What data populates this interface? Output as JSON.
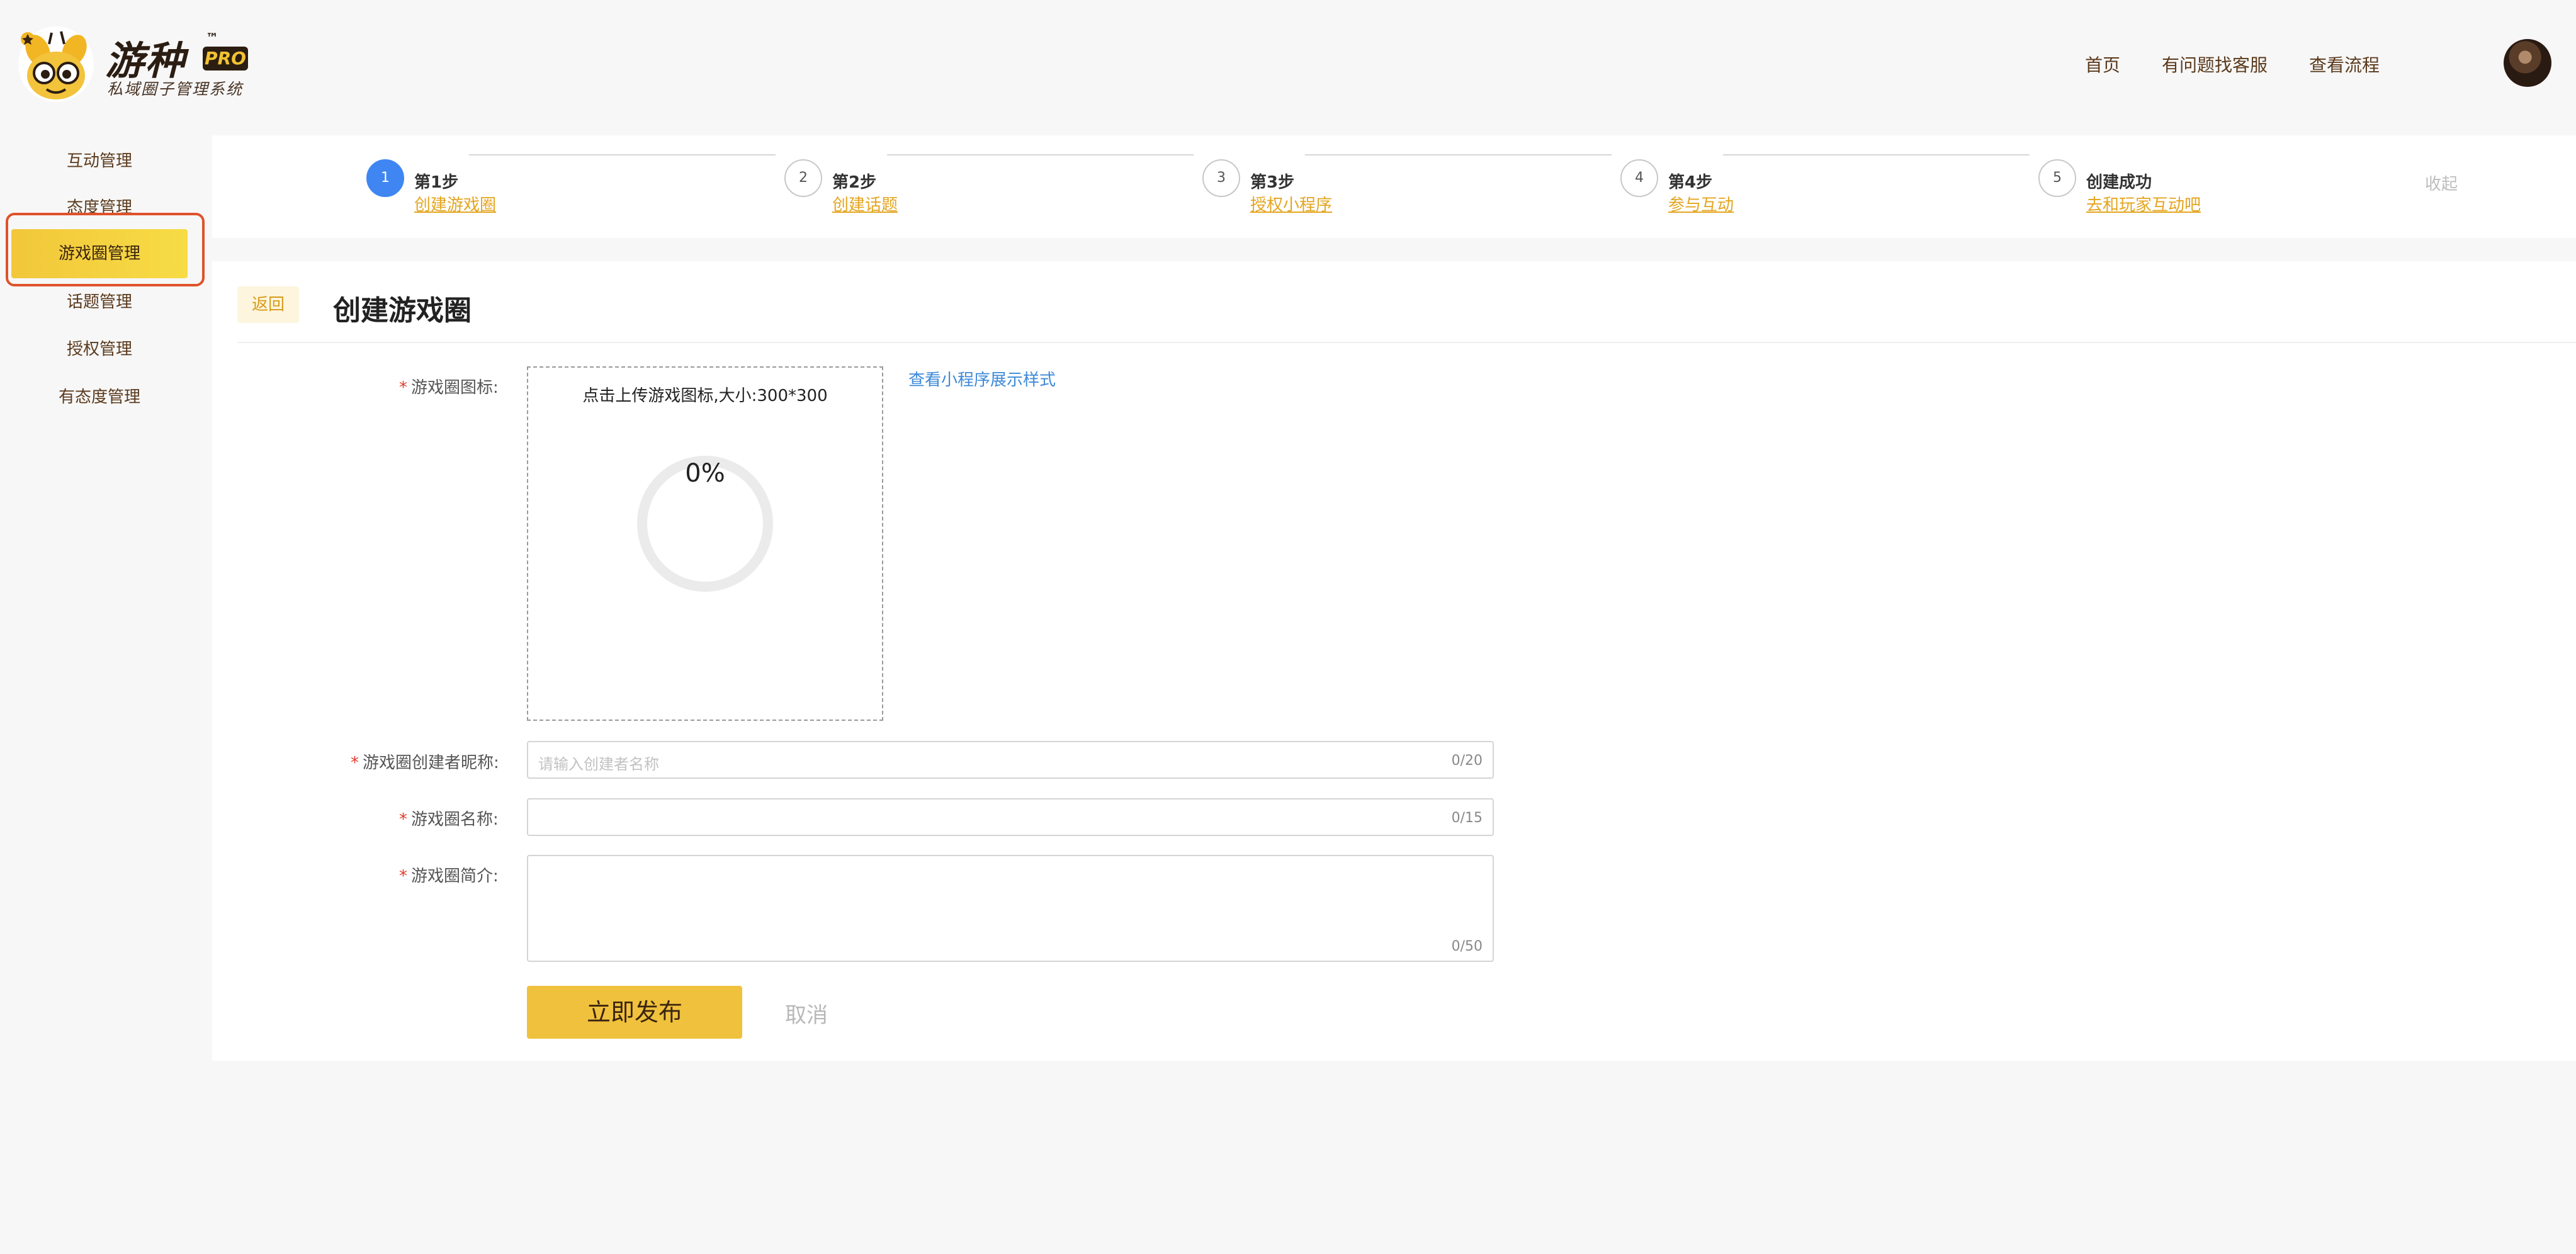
{
  "brand": {
    "name": "游种",
    "tm": "™",
    "badge": "PRO",
    "subtitle": "私域圈子管理系统"
  },
  "top_nav": {
    "home": "首页",
    "support": "有问题找客服",
    "process": "查看流程"
  },
  "sidebar": {
    "items": [
      {
        "label": "互动管理"
      },
      {
        "label": "态度管理"
      },
      {
        "label": "游戏圈管理"
      },
      {
        "label": "话题管理"
      },
      {
        "label": "授权管理"
      },
      {
        "label": "有态度管理"
      }
    ],
    "active": "游戏圈管理"
  },
  "steps": {
    "items": [
      {
        "num": "1",
        "title": "第1步",
        "link": "创建游戏圈"
      },
      {
        "num": "2",
        "title": "第2步",
        "link": "创建话题"
      },
      {
        "num": "3",
        "title": "第3步",
        "link": "授权小程序"
      },
      {
        "num": "4",
        "title": "第4步",
        "link": "参与互动"
      },
      {
        "num": "5",
        "title": "创建成功",
        "link": "去和玩家互动吧"
      }
    ],
    "current": 1,
    "collapse_label": "收起"
  },
  "form": {
    "back_label": "返回",
    "title": "创建游戏圈",
    "icon_label": "游戏圈图标:",
    "upload_hint": "点击上传游戏图标,大小:300*300",
    "upload_progress": "0%",
    "upload_progress_value": 0,
    "preview_link": "查看小程序展示样式",
    "creator_label": "游戏圈创建者昵称:",
    "creator_placeholder": "请输入创建者名称",
    "creator_count": "0/20",
    "name_label": "游戏圈名称:",
    "name_count": "0/15",
    "intro_label": "游戏圈简介:",
    "intro_count": "0/50",
    "required_mark": "*",
    "publish_label": "立即发布",
    "cancel_label": "取消"
  },
  "colors": {
    "accent_yellow": "#f0c13c",
    "step_active_blue": "#3f86f3",
    "link_orange": "#e4a51f",
    "link_blue": "#3d8ad8",
    "required_red": "#e03b2a",
    "highlight_outline": "#e0522a"
  }
}
